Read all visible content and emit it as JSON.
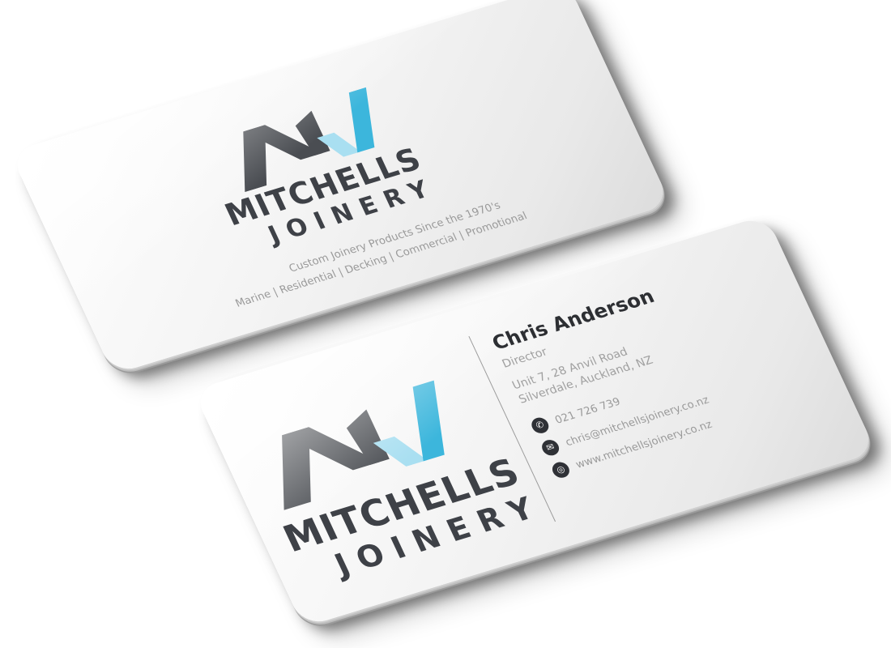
{
  "back_card": {
    "logo": {
      "word_1": "MITCHELLS",
      "word_2": "JOINERY",
      "colors": {
        "dark": "#4a4d52",
        "blue": "#3cb6dc",
        "light_blue": "#a9dff1"
      }
    },
    "tagline_1": "Custom Joinery Products Since the 1970's",
    "tagline_2": "Marine | Residential | Decking | Commercial | Promotional"
  },
  "front_card": {
    "logo": {
      "word_1": "MITCHELLS",
      "word_2": "JOINERY"
    },
    "name": "Chris Anderson",
    "role": "Director",
    "address_line_1": "Unit 7, 28 Anvil Road",
    "address_line_2": "Silverdale, Auckland, NZ",
    "contacts": [
      {
        "icon": "phone-icon",
        "glyph": "✆",
        "text": "021 726 739"
      },
      {
        "icon": "email-icon",
        "glyph": "✉",
        "text": "chris@mitchellsjoinery.co.nz"
      },
      {
        "icon": "web-icon",
        "glyph": "◎",
        "text": "www.mitchellsjoinery.co.nz"
      }
    ]
  }
}
